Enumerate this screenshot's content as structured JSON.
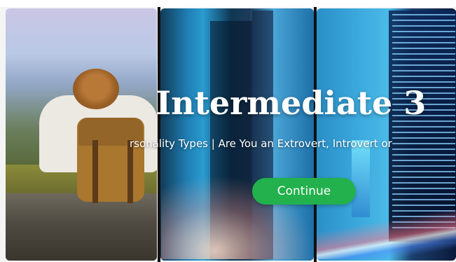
{
  "hero": {
    "title": "Intermediate 3",
    "subtitle": "rsonality Types  |  Are You an Extrovert, Introvert or",
    "continue_label": "Continue"
  },
  "colors": {
    "accent_button": "#22b14c",
    "title_text": "#ffffff"
  },
  "images": {
    "left_panel": "hiker-with-backpack-image",
    "middle_panel": "city-skyscrapers-image",
    "right_panel": "city-night-lights-image"
  }
}
